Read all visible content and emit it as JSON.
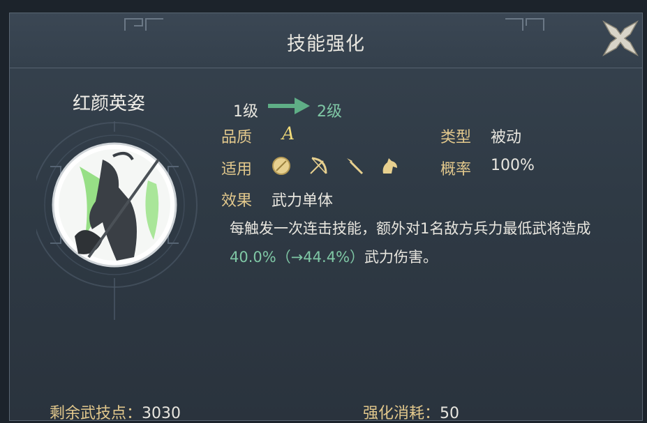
{
  "dialog": {
    "title": "技能强化",
    "close_icon": "close-x-icon"
  },
  "skill": {
    "name": "红颜英姿",
    "level_from": "1级",
    "level_to": "2级",
    "quality_label": "品质",
    "quality_value": "A",
    "type_label": "类型",
    "type_value": "被动",
    "apply_label": "适用",
    "apply_icons": [
      "shield-icon",
      "bow-icon",
      "spear-icon",
      "horse-icon"
    ],
    "chance_label": "概率",
    "chance_value": "100%",
    "effect_label": "效果",
    "effect_value": "武力单体",
    "desc_part1": "每触发一次连击技能，额外对1名敌方兵力最低武将造成",
    "desc_highlight": "40.0%（→44.4%）",
    "desc_part2": "武力伤害。"
  },
  "footer": {
    "remaining_label": "剩余武技点：",
    "remaining_value": "3030",
    "cost_label": "强化消耗：",
    "cost_value": "50"
  },
  "colors": {
    "gold": "#e2c88c",
    "green": "#7fc7a5",
    "text": "#e8e6df"
  }
}
